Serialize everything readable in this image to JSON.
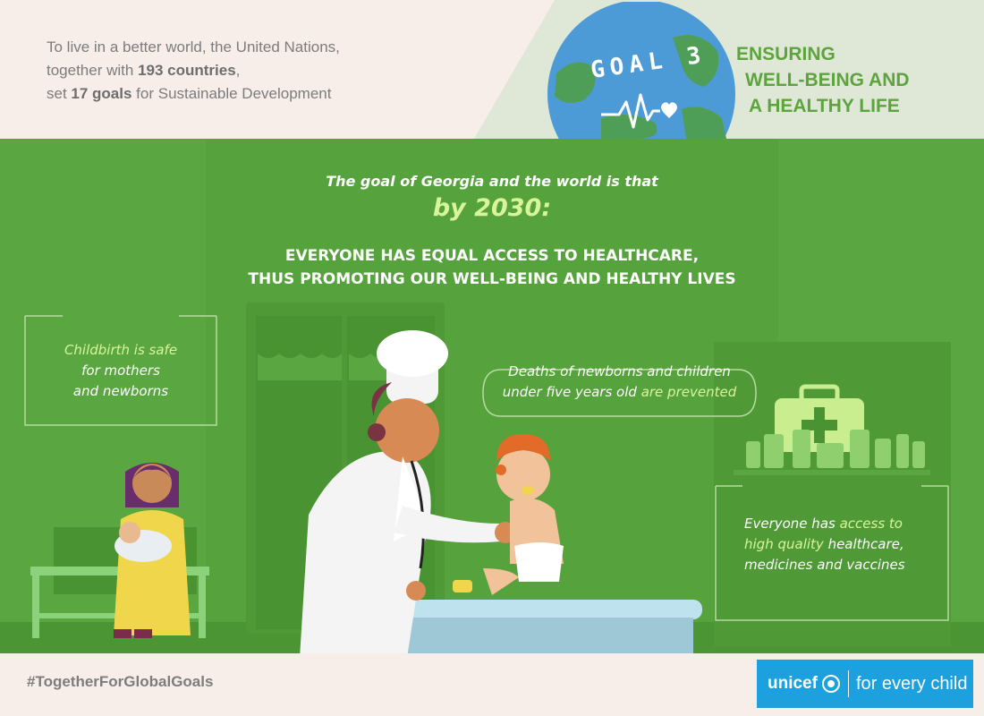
{
  "header": {
    "intro_line1": "To live in a better world, the United Nations,",
    "intro_line2_pre": "together with ",
    "intro_line2_bold": "193 countries",
    "intro_line2_post": ",",
    "intro_line3_pre": "set ",
    "intro_line3_bold": "17 goals",
    "intro_line3_post": " for Sustainable Development",
    "goal_badge": "GOAL 3",
    "goal_title_line1": "ENSURING",
    "goal_title_line2": "WELL-BEING AND",
    "goal_title_line3": "A HEALTHY LIFE"
  },
  "main": {
    "lead": "The goal of Georgia and the world is that",
    "year": "by 2030:",
    "headline_line1": "EVERYONE HAS EQUAL ACCESS TO HEALTHCARE,",
    "headline_line2": "THUS PROMOTING OUR WELL-BEING AND HEALTHY LIVES",
    "callout_left_hl": "Childbirth is safe",
    "callout_left_line2": "for mothers",
    "callout_left_line3": "and newborns",
    "callout_center_line1": "Deaths of newborns and children",
    "callout_center_line2_pre": "under five years old ",
    "callout_center_line2_hl": "are prevented",
    "callout_right_line1_pre": "Everyone has ",
    "callout_right_line1_hl": "access to",
    "callout_right_line2_hl": "high quality",
    "callout_right_line2_post": " healthcare,",
    "callout_right_line3": "medicines and vaccines"
  },
  "footer": {
    "hashtag": "#TogetherForGlobalGoals",
    "unicef_logo": "unicef",
    "unicef_tagline": "for every child"
  },
  "colors": {
    "scene_green": "#5aa640",
    "highlight": "#d9f599",
    "goal_green": "#5ea43e",
    "unicef_blue": "#1ca0de"
  }
}
